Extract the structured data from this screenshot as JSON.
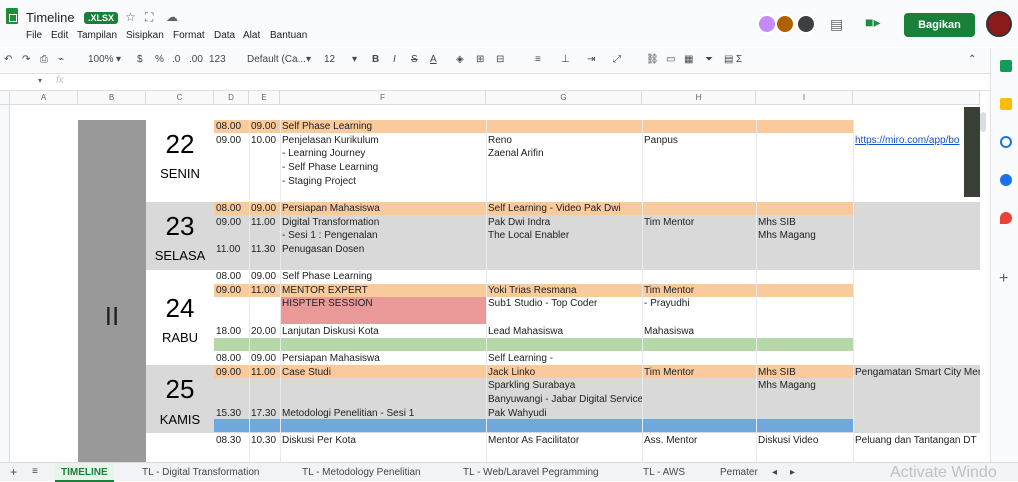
{
  "app": {
    "title": "Timeline",
    "badge": ".XLSX",
    "share_label": "Bagikan",
    "menu": [
      "File",
      "Edit",
      "Tampilan",
      "Sisipkan",
      "Format",
      "Data",
      "Alat",
      "Bantuan"
    ]
  },
  "toolbar": {
    "zoom": "100%",
    "currency": "$",
    "percent": "%",
    "dec_less": ".0",
    "dec_more": ".00",
    "more_formats": "123",
    "font": "Default (Ca...",
    "font_size": "12"
  },
  "formula_bar": {
    "fx": "fx"
  },
  "columns": [
    "A",
    "B",
    "C",
    "D",
    "E",
    "F",
    "G",
    "H",
    "I"
  ],
  "week_label": "II",
  "days": [
    {
      "num": "22",
      "name": "SENIN"
    },
    {
      "num": "23",
      "name": "SELASA"
    },
    {
      "num": "24",
      "name": "RABU"
    },
    {
      "num": "25",
      "name": "KAMIS"
    }
  ],
  "rows": [
    {
      "d": "08.00",
      "e": "09.00",
      "f": "Self Phase Learning",
      "g": "",
      "h": "",
      "i": "",
      "j": ""
    },
    {
      "d": "09.00",
      "e": "10.00",
      "f": "Penjelasan Kurikulum",
      "g": "Reno",
      "h": "Panpus",
      "i": "",
      "j": "https://miro.com/app/bo"
    },
    {
      "d": "",
      "e": "",
      "f": "- Learning Journey",
      "g": "Zaenal Arifin",
      "h": "",
      "i": "",
      "j": ""
    },
    {
      "d": "",
      "e": "",
      "f": "- Self Phase Learning",
      "g": "",
      "h": "",
      "i": "",
      "j": ""
    },
    {
      "d": "",
      "e": "",
      "f": "- Staging Project",
      "g": "",
      "h": "",
      "i": "",
      "j": ""
    },
    {
      "d": "",
      "e": "",
      "f": "",
      "g": "",
      "h": "",
      "i": "",
      "j": ""
    },
    {
      "d": "08.00",
      "e": "09.00",
      "f": "Persiapan Mahasiswa",
      "g": "Self Learning - Video Pak Dwi",
      "h": "",
      "i": "",
      "j": ""
    },
    {
      "d": "09.00",
      "e": "11.00",
      "f": "Digital Transformation",
      "g": "Pak Dwi Indra",
      "h": "Tim Mentor",
      "i": "Mhs SIB",
      "j": ""
    },
    {
      "d": "",
      "e": "",
      "f": "- Sesi 1 : Pengenalan",
      "g": "The Local Enabler",
      "h": "",
      "i": "Mhs Magang",
      "j": ""
    },
    {
      "d": "11.00",
      "e": "11.30",
      "f": "Penugasan Dosen",
      "g": "",
      "h": "",
      "i": "",
      "j": ""
    },
    {
      "d": "",
      "e": "",
      "f": "",
      "g": "",
      "h": "",
      "i": "",
      "j": ""
    },
    {
      "d": "08.00",
      "e": "09.00",
      "f": "Self Phase Learning",
      "g": "",
      "h": "",
      "i": "",
      "j": ""
    },
    {
      "d": "09.00",
      "e": "11.00",
      "f": "MENTOR EXPERT",
      "g": "Yoki Trias Resmana",
      "h": "Tim Mentor",
      "i": "",
      "j": ""
    },
    {
      "d": "",
      "e": "",
      "f": "HISPTER SESSION",
      "g": "Sub1 Studio - Top Coder",
      "h": "- Prayudhi",
      "i": "",
      "j": ""
    },
    {
      "d": "",
      "e": "",
      "f": "",
      "g": "",
      "h": "",
      "i": "",
      "j": ""
    },
    {
      "d": "18.00",
      "e": "20.00",
      "f": "Lanjutan Diskusi Kota",
      "g": "Lead Mahasiswa",
      "h": "Mahasiswa",
      "i": "",
      "j": ""
    },
    {
      "d": "",
      "e": "",
      "f": "",
      "g": "",
      "h": "",
      "i": "",
      "j": ""
    },
    {
      "d": "08.00",
      "e": "09.00",
      "f": "Persiapan Mahasiswa",
      "g": "Self Learning -",
      "h": "",
      "i": "",
      "j": ""
    },
    {
      "d": "09.00",
      "e": "11.00",
      "f": "Case Studi",
      "g": "Jack Linko",
      "h": "Tim Mentor",
      "i": "Mhs SIB",
      "j": "Pengamatan Smart City Men"
    },
    {
      "d": "",
      "e": "",
      "f": "",
      "g": "Sparkling Surabaya",
      "h": "",
      "i": "Mhs Magang",
      "j": ""
    },
    {
      "d": "",
      "e": "",
      "f": "",
      "g": "Banyuwangi - Jabar Digital Service",
      "h": "",
      "i": "",
      "j": ""
    },
    {
      "d": "15.30",
      "e": "17.30",
      "f": "Metodologi Penelitian - Sesi 1",
      "g": "Pak Wahyudi",
      "h": "",
      "i": "",
      "j": ""
    },
    {
      "d": "",
      "e": "",
      "f": "",
      "g": "",
      "h": "",
      "i": "",
      "j": ""
    },
    {
      "d": "08.30",
      "e": "10.30",
      "f": "Diskusi Per Kota",
      "g": "Mentor As Facilitator",
      "h": "Ass. Mentor",
      "i": "Diskusi Video",
      "j": "Peluang dan Tantangan DT"
    }
  ],
  "sheet_tabs": [
    "TIMELINE",
    "TL - Digital Transformation",
    "TL - Metodology Penelitian",
    "TL - Web/Laravel Pegramming",
    "TL - AWS",
    "Pemater"
  ],
  "watermark": "Activate Windo",
  "colors": {
    "orange": "#f9cb9c",
    "gray": "#d9d9d9",
    "darkgray": "#999999",
    "red": "#ea9999",
    "green": "#b6d7a8",
    "blue": "#6fa8dc",
    "link": "#1155cc",
    "brand": "#188038"
  }
}
